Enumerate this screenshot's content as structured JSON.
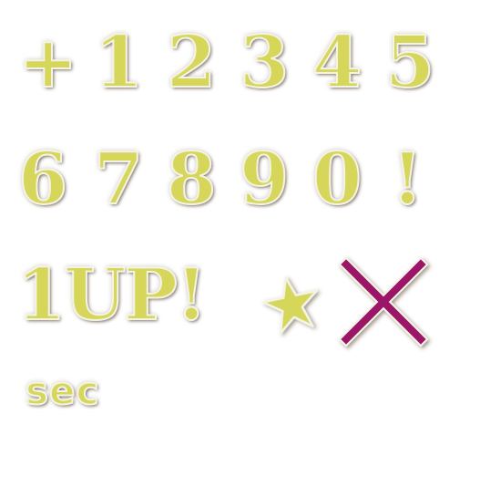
{
  "sprite_sheet": {
    "row1": [
      "+",
      "1",
      "2",
      "3",
      "4",
      "5"
    ],
    "row2": [
      "6",
      "7",
      "8",
      "9",
      "0",
      "!"
    ],
    "word_label": "1UP!",
    "unit_label": "sec",
    "icons": [
      "star-icon",
      "cross-icon"
    ],
    "colors": {
      "glyph_fill": "#d6d65a",
      "glyph_outline": "#f4f4e6",
      "cross": "#9b1768"
    }
  }
}
